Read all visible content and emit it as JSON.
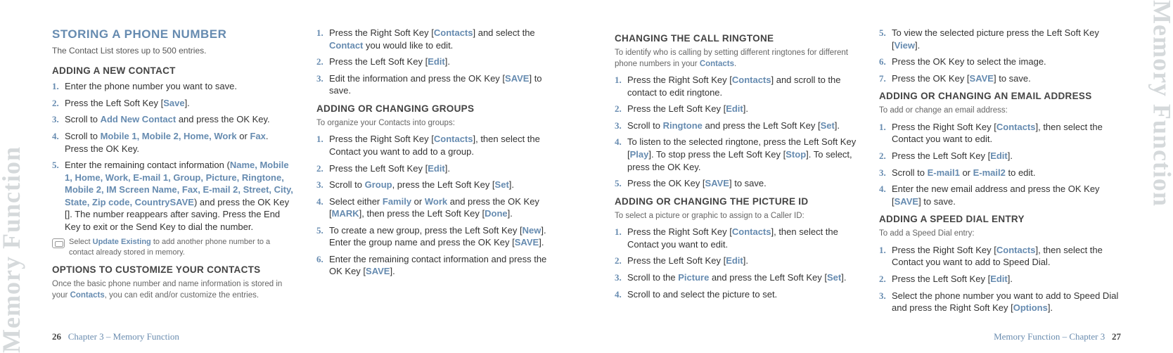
{
  "watermark": "Memory Function",
  "left_page": {
    "col1": {
      "title": "STORING A PHONE NUMBER",
      "subtitle": "The Contact List stores up to 500 entries.",
      "sec1": {
        "heading": "ADDING A NEW CONTACT",
        "steps": [
          {
            "n": "1.",
            "t": "Enter the phone number you want to save."
          },
          {
            "n": "2.",
            "pre": "Press the Left Soft Key [",
            "k": "Save",
            "post": "]."
          },
          {
            "n": "3.",
            "pre": "Scroll to ",
            "k": "Add New Contact",
            "post": " and press the OK Key."
          },
          {
            "n": "4.",
            "pre": "Scroll to ",
            "k": "Mobile 1, Mobile 2, Home, Work",
            "mid": " or ",
            "k2": "Fax",
            "post": ". Press the OK Key."
          },
          {
            "n": "5.",
            "pre": "Enter the remaining contact information (",
            "k": "Name, Mobile 1, Home, Work, E-mail 1, Group, Picture, Ringtone, Mobile 2, IM Screen Name, Fax, E-mail 2, Street, City, State, Zip code, Country",
            "post": ") and press the OK Key [",
            "k2": "SAVE",
            "post2": "]. The number reappears after saving. Press the End Key to exit or the Send Key to dial the number."
          }
        ],
        "tip_pre": "Select ",
        "tip_k": "Update Existing",
        "tip_post": " to add another phone number to a contact already stored in memory."
      },
      "sec2": {
        "heading": "OPTIONS TO CUSTOMIZE YOUR CONTACTS",
        "note_pre": "Once the basic phone number and name information is stored in your ",
        "note_k": "Contacts",
        "note_post": ", you can edit and/or customize the entries."
      }
    },
    "col2": {
      "intro_steps": [
        {
          "n": "1.",
          "pre": "Press the Right Soft Key [",
          "k": "Contacts",
          "mid": "] and select the ",
          "k2": "Contact",
          "post": " you would like to edit."
        },
        {
          "n": "2.",
          "pre": "Press the Left Soft Key [",
          "k": "Edit",
          "post": "]."
        },
        {
          "n": "3.",
          "pre": "Edit the information and press the OK Key [",
          "k": "SAVE",
          "post": "] to save."
        }
      ],
      "sec1": {
        "heading": "ADDING OR CHANGING GROUPS",
        "note": "To organize your Contacts into groups:",
        "steps": [
          {
            "n": "1.",
            "pre": "Press the Right Soft Key [",
            "k": "Contacts",
            "post": "], then select the Contact you want to add to a group."
          },
          {
            "n": "2.",
            "pre": "Press the Left Soft Key [",
            "k": "Edit",
            "post": "]."
          },
          {
            "n": "3.",
            "pre": "Scroll to ",
            "k": "Group",
            "mid": ", press the Left Soft Key [",
            "k2": "Set",
            "post": "]."
          },
          {
            "n": "4.",
            "pre": "Select either ",
            "k": "Family",
            "mid": " or ",
            "k2": "Work",
            "mid2": " and press the OK Key [",
            "k3": "MARK",
            "mid3": "], then press the Left Soft Key [",
            "k4": "Done",
            "post": "]."
          },
          {
            "n": "5.",
            "pre": "To create a new group, press the Left Soft Key [",
            "k": "New",
            "mid": "]. Enter the group name and press the OK Key [",
            "k2": "SAVE",
            "post": "]."
          },
          {
            "n": "6.",
            "pre": "Enter the remaining contact information and press the OK Key [",
            "k": "SAVE",
            "post": "]."
          }
        ]
      }
    },
    "footer_page": "26",
    "footer_text": "Chapter 3 – Memory Function"
  },
  "right_page": {
    "col1": {
      "sec1": {
        "heading": "CHANGING THE CALL RINGTONE",
        "note_pre": "To identify who is calling by setting different ringtones for different phone numbers in your ",
        "note_k": "Contacts",
        "note_post": ".",
        "steps": [
          {
            "n": "1.",
            "pre": "Press the Right Soft Key [",
            "k": "Contacts",
            "post": "] and scroll to the contact to edit ringtone."
          },
          {
            "n": "2.",
            "pre": "Press the Left Soft Key [",
            "k": "Edit",
            "post": "]."
          },
          {
            "n": "3.",
            "pre": "Scroll to ",
            "k": "Ringtone",
            "mid": " and press the Left Soft Key [",
            "k2": "Set",
            "post": "]."
          },
          {
            "n": "4.",
            "pre": "To listen to the selected ringtone, press the Left Soft Key [",
            "k": "Play",
            "mid": "]. To stop press the Left Soft Key [",
            "k2": "Stop",
            "post": "]. To select, press the OK Key."
          },
          {
            "n": "5.",
            "pre": "Press the OK Key [",
            "k": "SAVE",
            "post": "] to save."
          }
        ]
      },
      "sec2": {
        "heading": "ADDING OR CHANGING THE PICTURE ID",
        "note": "To select a picture or graphic to assign to a Caller ID:",
        "steps": [
          {
            "n": "1.",
            "pre": "Press the Right Soft Key [",
            "k": "Contacts",
            "post": "], then select the Contact you want to edit."
          },
          {
            "n": "2.",
            "pre": "Press the Left Soft Key [",
            "k": "Edit",
            "post": "]."
          },
          {
            "n": "3.",
            "pre": "Scroll to the ",
            "k": "Picture",
            "mid": " and press the Left Soft Key [",
            "k2": "Set",
            "post": "]."
          },
          {
            "n": "4.",
            "t": "Scroll to and select the picture to set."
          }
        ]
      }
    },
    "col2": {
      "intro_steps": [
        {
          "n": "5.",
          "pre": "To view the selected picture press the Left Soft Key [",
          "k": "View",
          "post": "]."
        },
        {
          "n": "6.",
          "t": "Press the OK Key to select the image."
        },
        {
          "n": "7.",
          "pre": "Press the OK Key [",
          "k": "SAVE",
          "post": "] to save."
        }
      ],
      "sec1": {
        "heading": "ADDING OR CHANGING AN EMAIL ADDRESS",
        "note": "To add or change an email address:",
        "steps": [
          {
            "n": "1.",
            "pre": "Press the Right Soft Key [",
            "k": "Contacts",
            "post": "], then select the Contact you want to edit."
          },
          {
            "n": "2.",
            "pre": "Press the Left Soft Key [",
            "k": "Edit",
            "post": "]."
          },
          {
            "n": "3.",
            "pre": "Scroll to ",
            "k": "E-mail1",
            "mid": " or ",
            "k2": "E-mail2",
            "post": " to edit."
          },
          {
            "n": "4.",
            "pre": "Enter the new email address and press the OK Key [",
            "k": "SAVE",
            "post": "] to save."
          }
        ]
      },
      "sec2": {
        "heading": "ADDING A SPEED DIAL ENTRY",
        "note": "To add a Speed Dial entry:",
        "steps": [
          {
            "n": "1.",
            "pre": "Press the Right Soft Key [",
            "k": "Contacts",
            "post": "], then select the Contact you want to add to Speed Dial."
          },
          {
            "n": "2.",
            "pre": "Press the Left Soft Key [",
            "k": "Edit",
            "post": "]."
          },
          {
            "n": "3.",
            "pre": "Select the phone number you want to add to Speed Dial and press the Right Soft Key [",
            "k": "Options",
            "post": "]."
          }
        ]
      }
    },
    "footer_text": "Memory Function – Chapter 3",
    "footer_page": "27"
  }
}
